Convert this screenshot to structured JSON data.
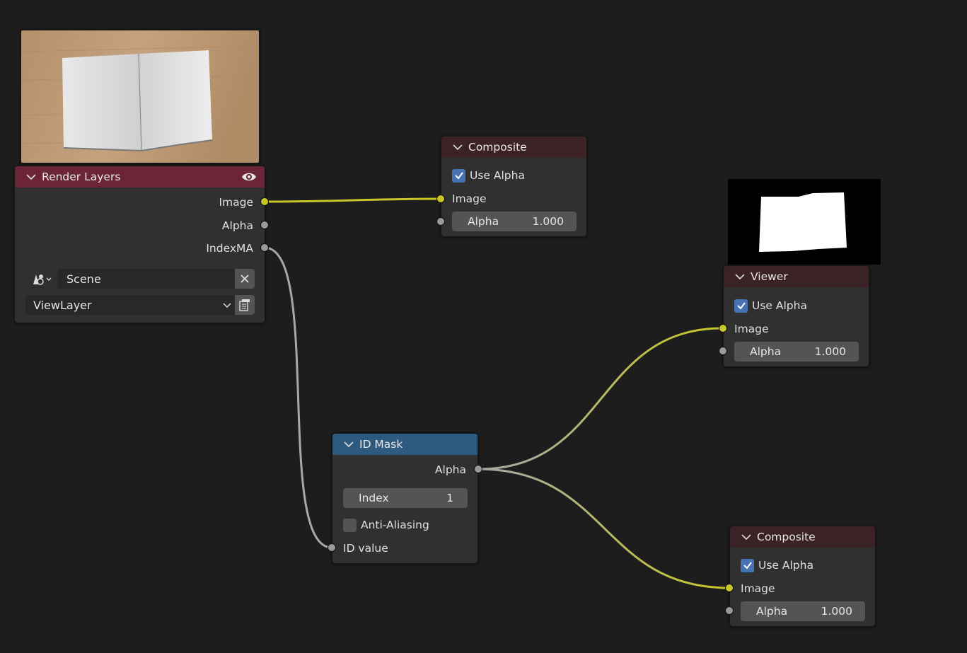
{
  "nodes": {
    "render_layers": {
      "title": "Render Layers",
      "outputs": [
        "Image",
        "Alpha",
        "IndexMA"
      ],
      "scene": "Scene",
      "view_layer": "ViewLayer"
    },
    "composite_top": {
      "title": "Composite",
      "use_alpha_label": "Use Alpha",
      "image_label": "Image",
      "alpha_label": "Alpha",
      "alpha_value": "1.000"
    },
    "viewer": {
      "title": "Viewer",
      "use_alpha_label": "Use Alpha",
      "image_label": "Image",
      "alpha_label": "Alpha",
      "alpha_value": "1.000"
    },
    "id_mask": {
      "title": "ID Mask",
      "output_label": "Alpha",
      "index_label": "Index",
      "index_value": "1",
      "anti_aliasing_label": "Anti-Aliasing",
      "id_value_label": "ID value"
    },
    "composite_bottom": {
      "title": "Composite",
      "use_alpha_label": "Use Alpha",
      "image_label": "Image",
      "alpha_label": "Alpha",
      "alpha_value": "1.000"
    }
  },
  "colors": {
    "background": "#1d1d1d",
    "node_body": "#303030",
    "render_layers_header": "#6b2536",
    "output_header": "#3a2227",
    "id_mask_header": "#2e5a80",
    "socket_color": "#c7c729",
    "socket_value": "#9a9a9a",
    "checkbox_on": "#4772b3"
  }
}
